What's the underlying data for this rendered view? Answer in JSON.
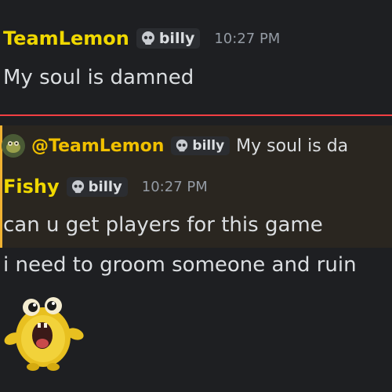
{
  "colors": {
    "author_yellow": "#f0d800",
    "divider_red": "#f23f43",
    "highlight_border": "#f0b232"
  },
  "message1": {
    "author": "TeamLemon",
    "tag": "billy",
    "tag_icon": "skull-icon",
    "time": "10:27 PM",
    "text": "My soul is damned"
  },
  "reply": {
    "avatar_icon": "reply-avatar",
    "mention": "@TeamLemon",
    "tag": "billy",
    "text": "My soul is da"
  },
  "message2": {
    "author": "Fishy",
    "tag": "billy",
    "time": "10:27 PM",
    "text": "can u get players for this game"
  },
  "message3": {
    "text": "i need to groom someone and ruin",
    "sticker": "yellow-creature-sticker"
  }
}
